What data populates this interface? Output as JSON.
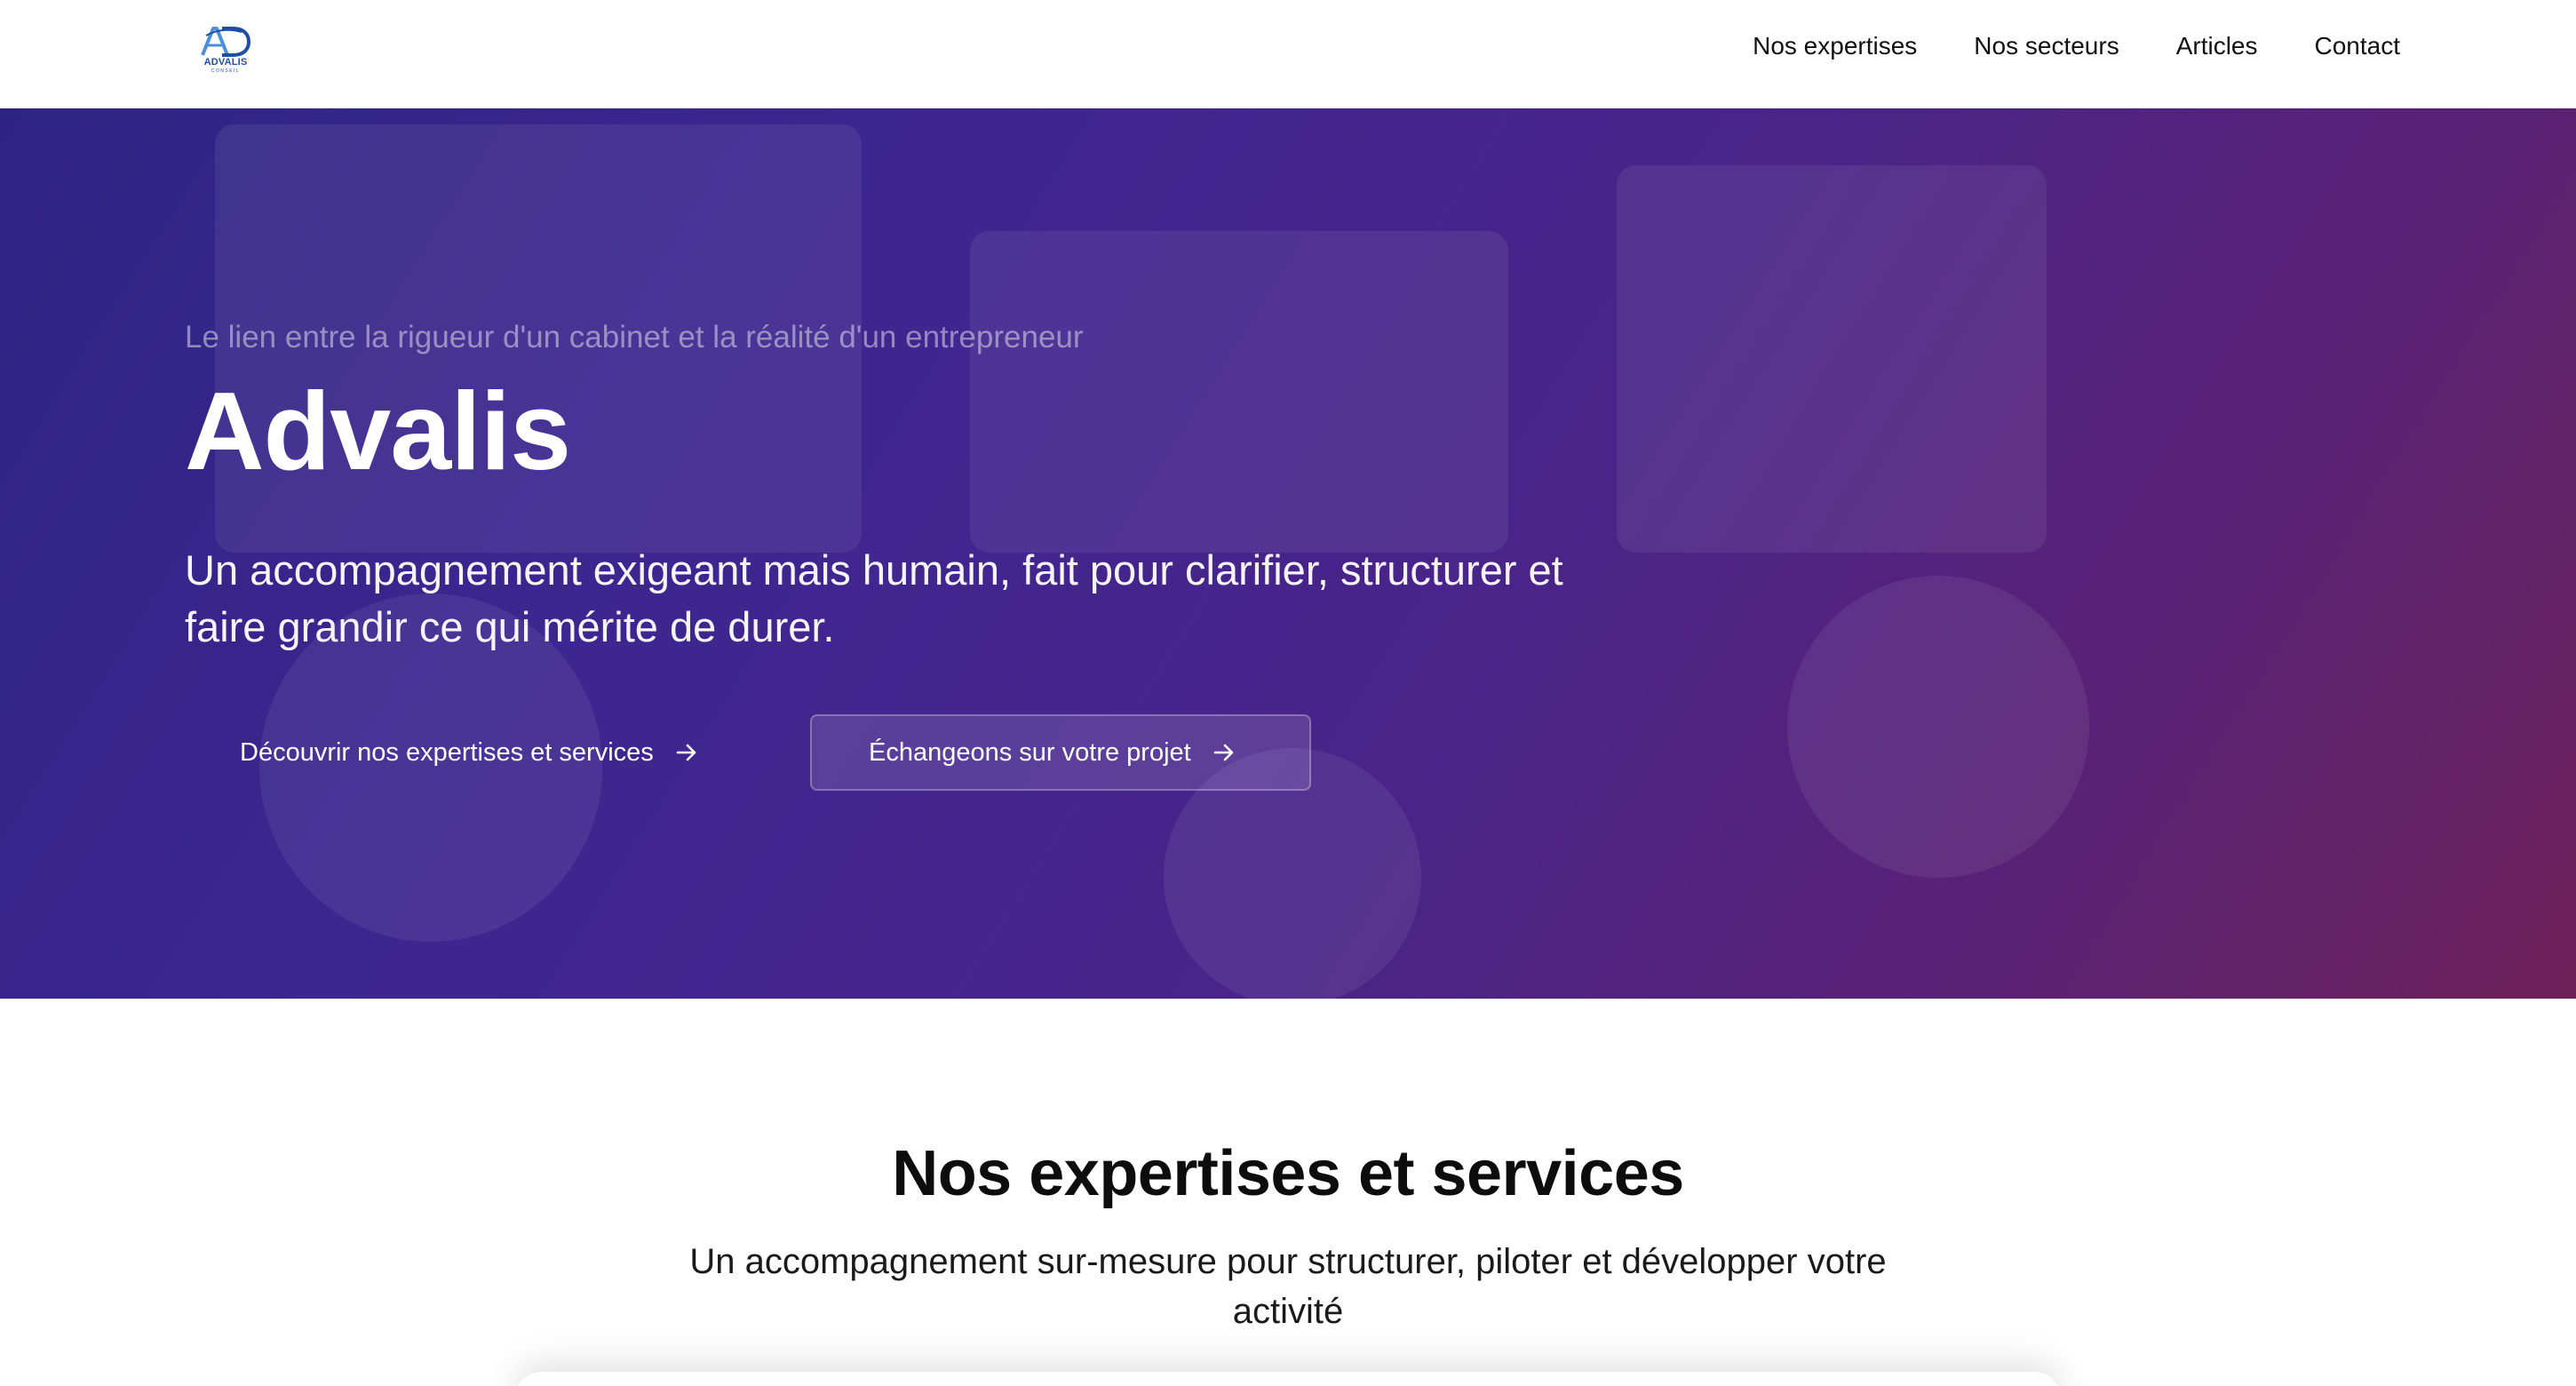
{
  "header": {
    "logo": {
      "mark": "AD",
      "name": "ADVALIS",
      "sub": "CONSEIL",
      "colors": {
        "primary": "#1f4fa3",
        "accent": "#4a8fd8"
      }
    },
    "nav": [
      {
        "label": "Nos expertises"
      },
      {
        "label": "Nos secteurs"
      },
      {
        "label": "Articles"
      },
      {
        "label": "Contact"
      }
    ]
  },
  "hero": {
    "tagline": "Le lien entre la rigueur d'un cabinet et la réalité d'un entrepreneur",
    "title": "Advalis",
    "subtitle": "Un accompagnement exigeant mais humain, fait pour clarifier, structurer et faire grandir ce qui mérite de durer.",
    "primary_button": {
      "label": "Découvrir nos expertises et services",
      "icon": "arrow-right-icon"
    },
    "secondary_button": {
      "label": "Échangeons sur votre projet",
      "icon": "arrow-right-icon"
    },
    "gradient": {
      "from": "#2f2483",
      "via": "#4a2489",
      "to": "#6e2158"
    }
  },
  "services": {
    "title": "Nos expertises et services",
    "subtitle": "Un accompagnement sur-mesure pour structurer, piloter et développer votre activité"
  }
}
